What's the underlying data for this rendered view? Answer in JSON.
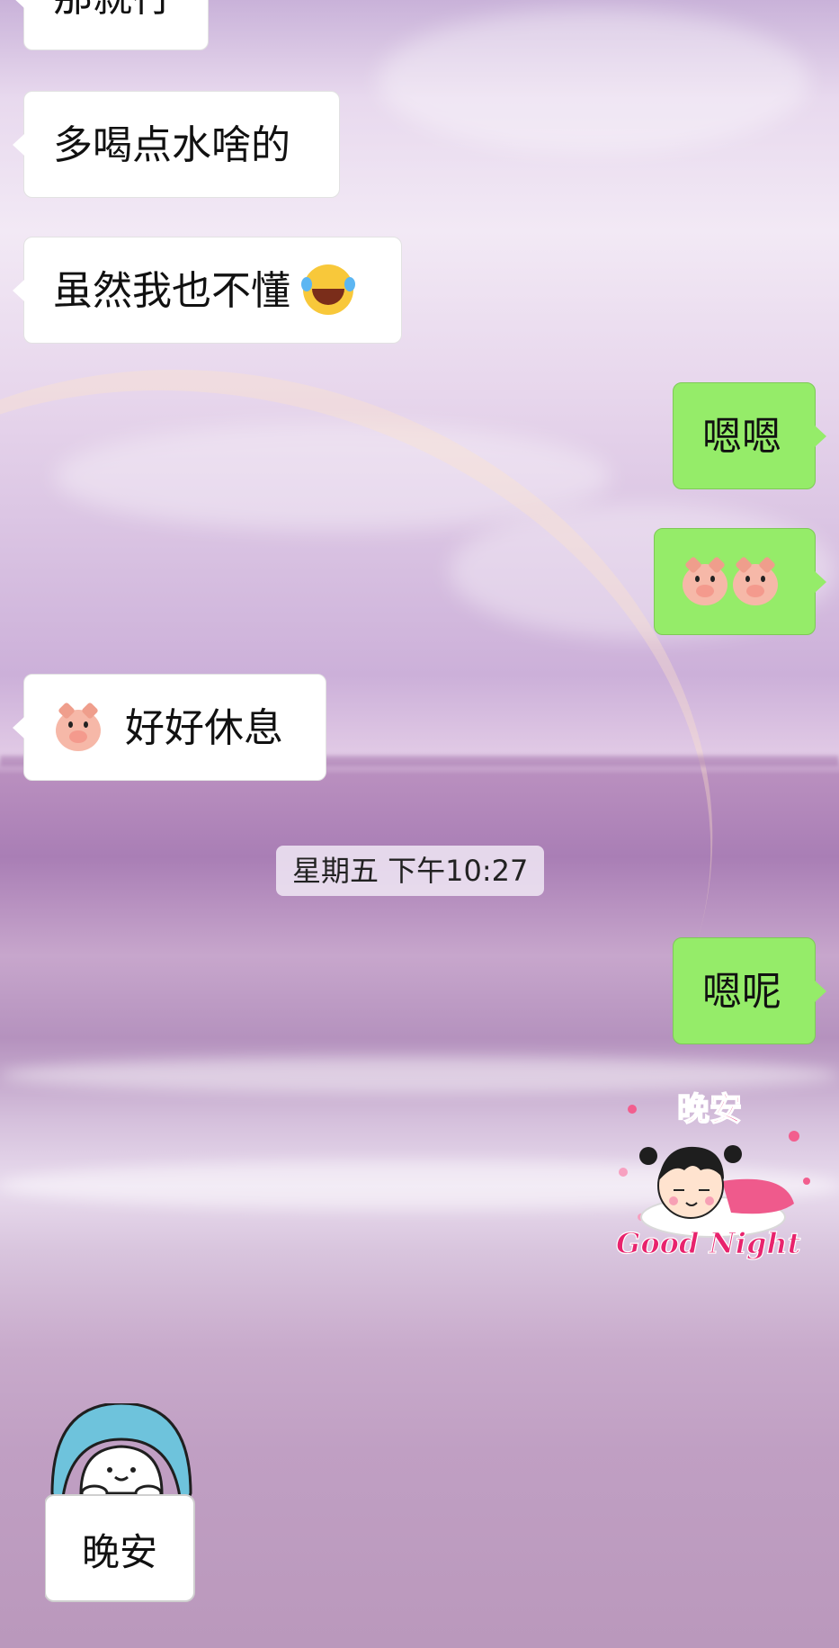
{
  "chat": {
    "messages": [
      {
        "side": "in",
        "text": "那就行"
      },
      {
        "side": "in",
        "text": "多喝点水啥的"
      },
      {
        "side": "in",
        "text": "虽然我也不懂",
        "emoji": "laughing-tears-emoji"
      },
      {
        "side": "out",
        "text": "嗯嗯"
      },
      {
        "side": "out",
        "text": "",
        "emoji": "pig-face-emoji x2"
      },
      {
        "side": "in",
        "text": "好好休息",
        "emoji": "pig-face-emoji"
      },
      {
        "side": "out",
        "text": "嗯呢"
      }
    ],
    "timestamp": "星期五 下午10:27",
    "stickers": {
      "goodnight": {
        "title": "晚安",
        "caption": "Good Night"
      },
      "mochi": {
        "caption": "晚安"
      }
    }
  },
  "colors": {
    "incoming_bubble": "#ffffff",
    "outgoing_bubble": "#95ec69"
  }
}
